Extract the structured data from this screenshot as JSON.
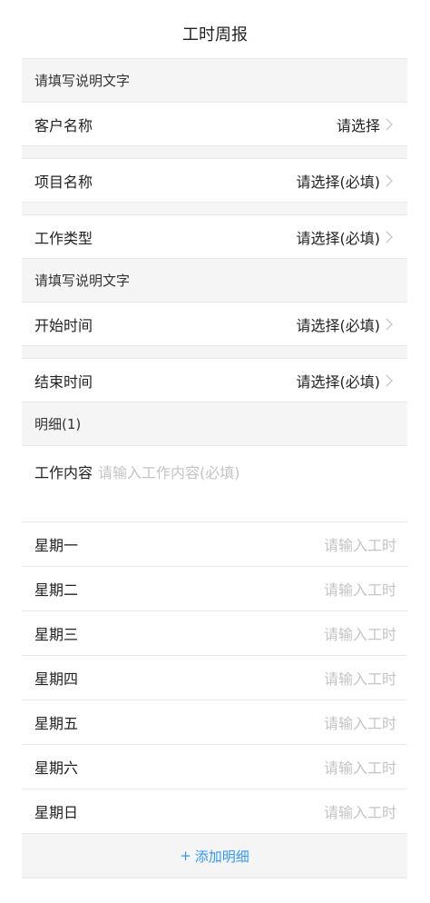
{
  "page": {
    "title": "工时周报"
  },
  "form": {
    "section1_header": "请填写说明文字",
    "customer": {
      "label": "客户名称",
      "value": "请选择"
    },
    "project": {
      "label": "项目名称",
      "value": "请选择(必填)"
    },
    "work_type": {
      "label": "工作类型",
      "value": "请选择(必填)"
    },
    "section2_header": "请填写说明文字",
    "start_time": {
      "label": "开始时间",
      "value": "请选择(必填)"
    },
    "end_time": {
      "label": "结束时间",
      "value": "请选择(必填)"
    },
    "detail_header": "明细(1)",
    "work_content": {
      "label": "工作内容",
      "placeholder": "请输入工作内容(必填)"
    },
    "days": [
      {
        "label": "星期一",
        "placeholder": "请输入工时"
      },
      {
        "label": "星期二",
        "placeholder": "请输入工时"
      },
      {
        "label": "星期三",
        "placeholder": "请输入工时"
      },
      {
        "label": "星期四",
        "placeholder": "请输入工时"
      },
      {
        "label": "星期五",
        "placeholder": "请输入工时"
      },
      {
        "label": "星期六",
        "placeholder": "请输入工时"
      },
      {
        "label": "星期日",
        "placeholder": "请输入工时"
      }
    ],
    "add_detail": {
      "plus": "+",
      "label": "添加明细"
    }
  },
  "colors": {
    "accent": "#3296fa",
    "background": "#f5f5f6",
    "placeholder": "#c4c4c6"
  },
  "icons": {
    "chevron": "chevron-right-icon"
  }
}
